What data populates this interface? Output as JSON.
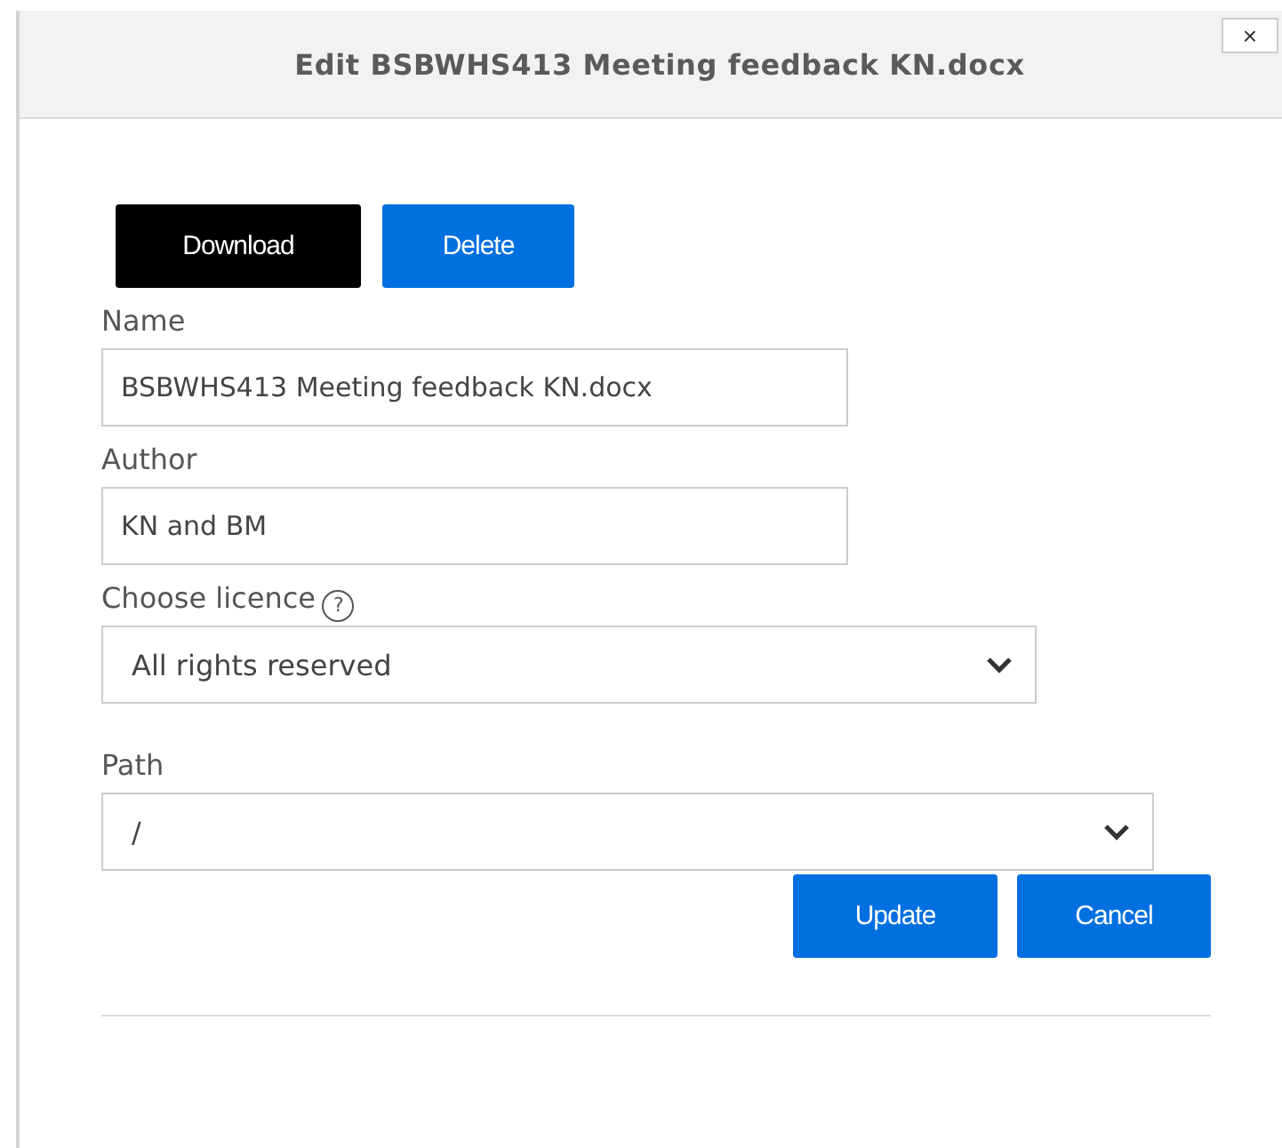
{
  "dialog": {
    "title": "Edit BSBWHS413 Meeting feedback KN.docx",
    "close": "×"
  },
  "actions": [
    "Download",
    "Delete"
  ],
  "fields": [
    {
      "kind": "text",
      "label": "Name",
      "value": "BSBWHS413 Meeting feedback KN.docx"
    },
    {
      "kind": "text",
      "label": "Author",
      "value": "KN and BM"
    },
    {
      "kind": "select",
      "label": "Choose licence",
      "help": "?",
      "value": "All rights reserved"
    },
    {
      "kind": "select",
      "label": "Path",
      "value": "/"
    }
  ],
  "buttons": [
    "Update",
    "Cancel"
  ]
}
